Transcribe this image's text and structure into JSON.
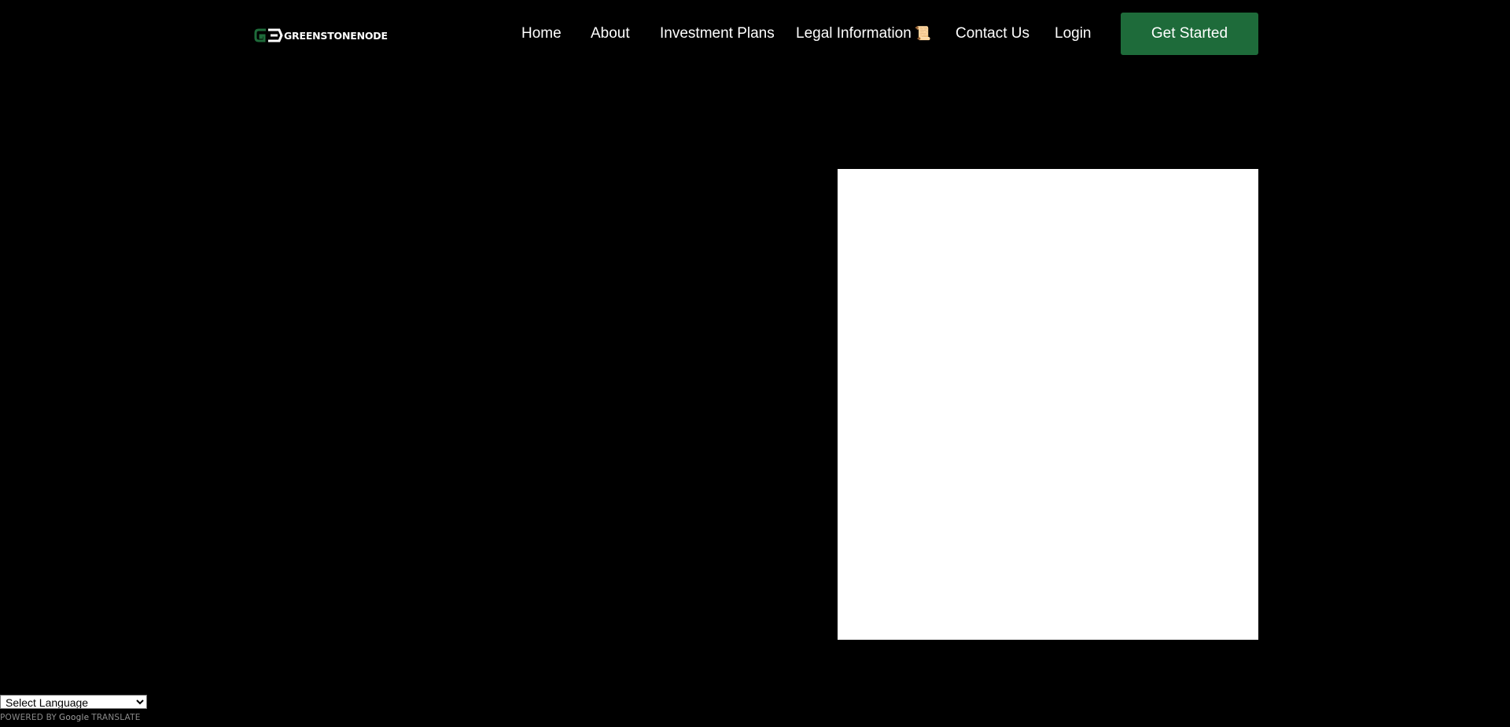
{
  "header": {
    "logo_text": "GREENSTONENODE",
    "nav": [
      {
        "label": "Home"
      },
      {
        "label": "About"
      },
      {
        "label": "Investment Plans"
      },
      {
        "label": "Legal Information",
        "emoji": "📜"
      },
      {
        "label": "Contact Us"
      },
      {
        "label": "Login"
      }
    ],
    "cta_label": "Get Started"
  },
  "translate": {
    "selected": "Select Language",
    "powered_by": "POWERED BY",
    "google": "Google",
    "translate_word": "TRANSLATE"
  },
  "colors": {
    "background": "#000000",
    "accent": "#1e6b3a",
    "text": "#ffffff"
  }
}
